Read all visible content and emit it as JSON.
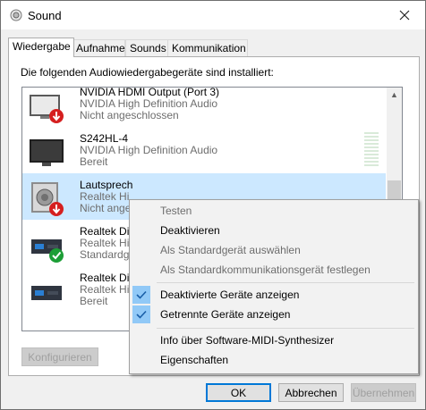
{
  "window": {
    "title": "Sound",
    "close_icon": "close-icon"
  },
  "tabs": [
    {
      "label": "Wiedergabe",
      "active": true
    },
    {
      "label": "Aufnahme",
      "active": false
    },
    {
      "label": "Sounds",
      "active": false
    },
    {
      "label": "Kommunikation",
      "active": false
    }
  ],
  "panel": {
    "heading": "Die folgenden Audiowiedergabegeräte sind installiert:"
  },
  "devices": [
    {
      "name": "NVIDIA HDMI Output (Port 3)",
      "driver": "NVIDIA High Definition Audio",
      "status": "Nicht angeschlossen",
      "icon": "monitor-disconnected-icon"
    },
    {
      "name": "S242HL-4",
      "driver": "NVIDIA High Definition Audio",
      "status": "Bereit",
      "icon": "monitor-icon"
    },
    {
      "name": "Lautsprech",
      "driver": "Realtek Hi",
      "status": "Nicht ange",
      "icon": "speaker-disconnected-icon",
      "selected": true
    },
    {
      "name": "Realtek Di",
      "driver": "Realtek Hi",
      "status": "Standardg",
      "icon": "digital-output-default-icon"
    },
    {
      "name": "Realtek Di",
      "driver": "Realtek Hi",
      "status": "Bereit",
      "icon": "digital-output-icon"
    }
  ],
  "buttons": {
    "configure": "Konfigurieren",
    "ok": "OK",
    "cancel": "Abbrechen",
    "apply": "Übernehmen"
  },
  "context_menu": {
    "items": [
      {
        "label": "Testen",
        "enabled": false,
        "checked": false
      },
      {
        "label": "Deaktivieren",
        "enabled": true,
        "checked": false
      },
      {
        "label": "Als Standardgerät auswählen",
        "enabled": false,
        "checked": false
      },
      {
        "label": "Als Standardkommunikationsgerät festlegen",
        "enabled": false,
        "checked": false
      },
      {
        "label": "Deaktivierte Geräte anzeigen",
        "enabled": true,
        "checked": true
      },
      {
        "label": "Getrennte Geräte anzeigen",
        "enabled": true,
        "checked": true
      },
      {
        "label": "Info über Software-MIDI-Synthesizer",
        "enabled": true,
        "checked": false
      },
      {
        "label": "Eigenschaften",
        "enabled": true,
        "checked": false
      }
    ]
  },
  "colors": {
    "selection": "#cce8ff",
    "check_highlight": "#91c9f7",
    "default_button_border": "#0078d7",
    "status_red": "#d51f1f",
    "status_green": "#1c9e36"
  }
}
